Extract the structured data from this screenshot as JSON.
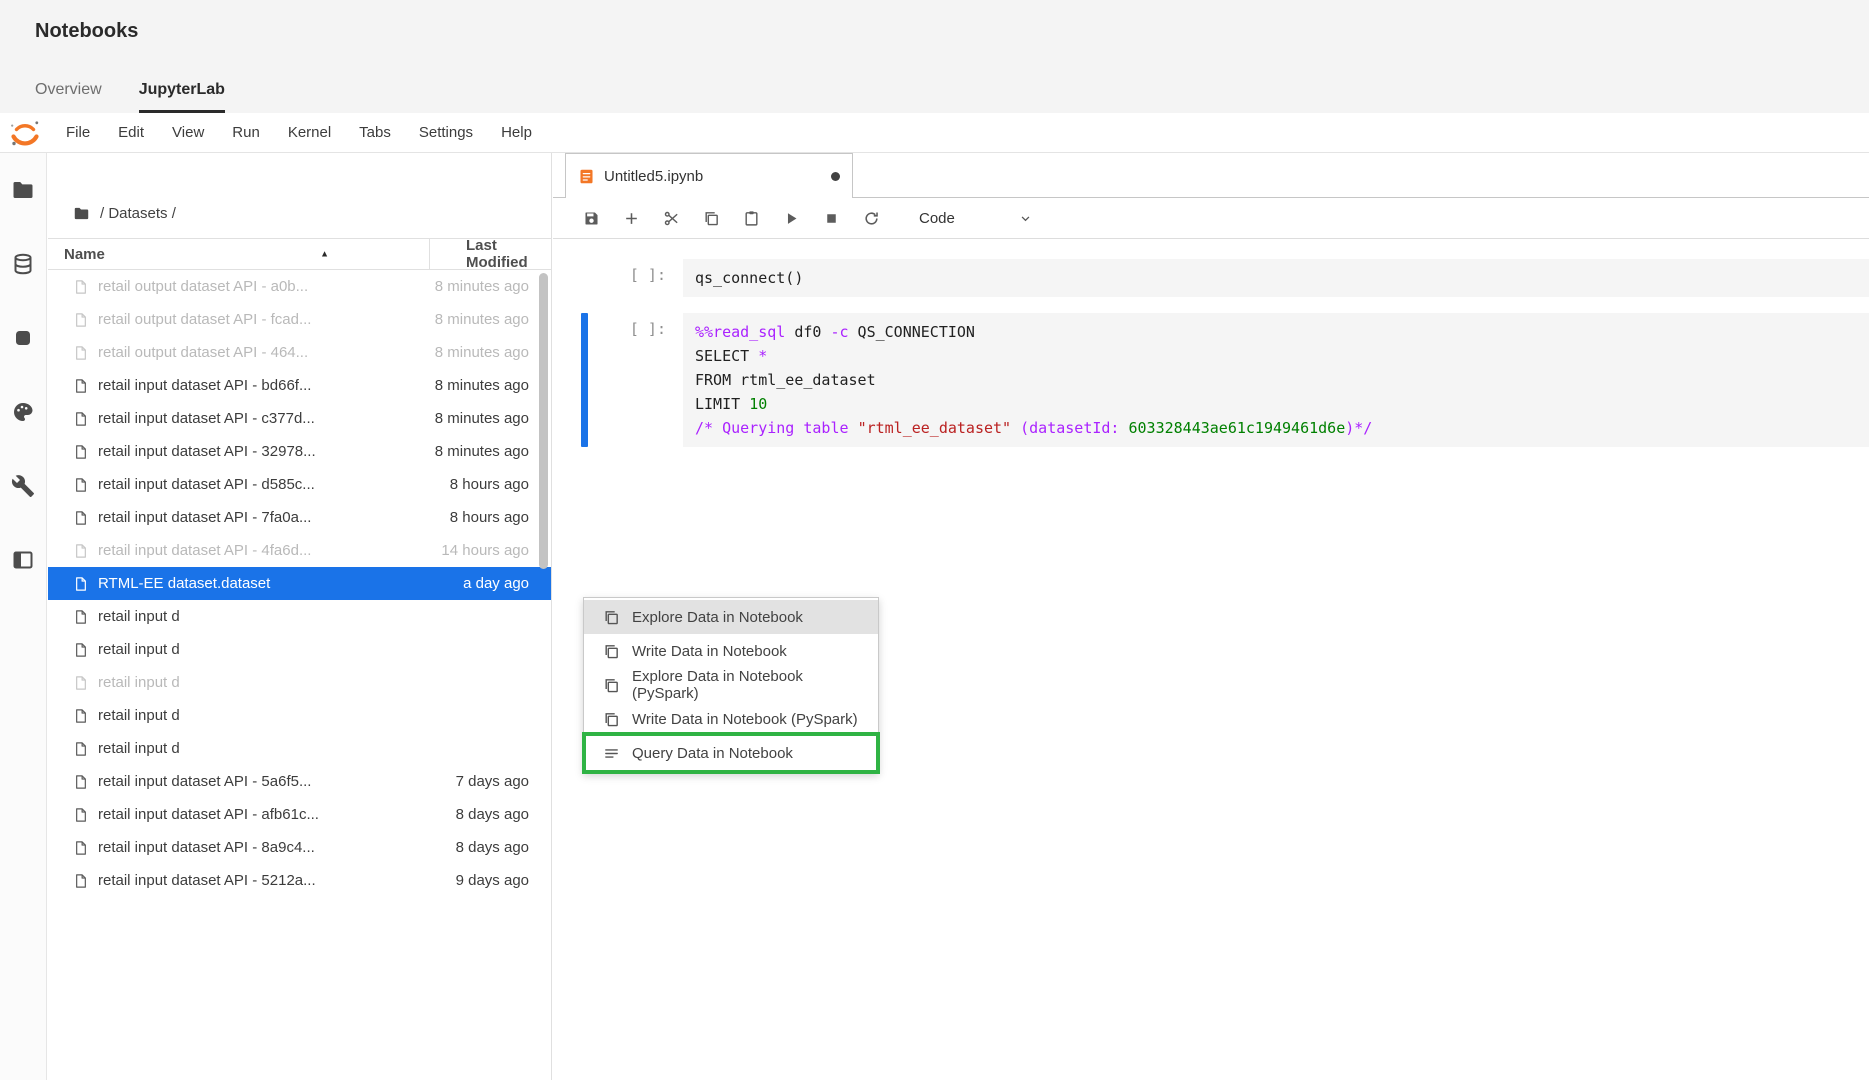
{
  "colors": {
    "brand_orange": "#F37726",
    "selection_blue": "#1A73E8",
    "annotation_green": "#2FB344",
    "syntax_magic": "#AA22FF",
    "syntax_number": "#008000",
    "syntax_string": "#BA2121"
  },
  "header": {
    "title": "Notebooks",
    "tabs": [
      {
        "label": "Overview",
        "active": false
      },
      {
        "label": "JupyterLab",
        "active": true
      }
    ]
  },
  "menubar": {
    "items": [
      "File",
      "Edit",
      "View",
      "Run",
      "Kernel",
      "Tabs",
      "Settings",
      "Help"
    ]
  },
  "sidebar": {
    "icons": [
      "folder",
      "database",
      "stop",
      "palette",
      "wrench",
      "panel"
    ]
  },
  "filebrowser": {
    "breadcrumb": "/ Datasets /",
    "columns": {
      "name": "Name",
      "modified": "Last Modified"
    },
    "sort": {
      "column": "Name",
      "direction": "ascending",
      "icon": "▲"
    },
    "rows": [
      {
        "name": "retail output dataset API - a0b...",
        "modified": "8 minutes ago",
        "state": "dim"
      },
      {
        "name": "retail output dataset API - fcad...",
        "modified": "8 minutes ago",
        "state": "dim"
      },
      {
        "name": "retail output dataset API - 464...",
        "modified": "8 minutes ago",
        "state": "dim"
      },
      {
        "name": "retail input dataset API - bd66f...",
        "modified": "8 minutes ago",
        "state": "normal"
      },
      {
        "name": "retail input dataset API - c377d...",
        "modified": "8 minutes ago",
        "state": "normal"
      },
      {
        "name": "retail input dataset API - 32978...",
        "modified": "8 minutes ago",
        "state": "normal"
      },
      {
        "name": "retail input dataset API - d585c...",
        "modified": "8 hours ago",
        "state": "normal"
      },
      {
        "name": "retail input dataset API - 7fa0a...",
        "modified": "8 hours ago",
        "state": "normal"
      },
      {
        "name": "retail input dataset API - 4fa6d...",
        "modified": "14 hours ago",
        "state": "dim"
      },
      {
        "name": "RTML-EE dataset.dataset",
        "modified": "a day ago",
        "state": "selected"
      },
      {
        "name": "retail input d",
        "modified": "",
        "state": "normal"
      },
      {
        "name": "retail input d",
        "modified": "",
        "state": "normal"
      },
      {
        "name": "retail input d",
        "modified": "",
        "state": "dim"
      },
      {
        "name": "retail input d",
        "modified": "",
        "state": "normal"
      },
      {
        "name": "retail input d",
        "modified": "",
        "state": "normal"
      },
      {
        "name": "retail input dataset API - 5a6f5...",
        "modified": "7 days ago",
        "state": "normal"
      },
      {
        "name": "retail input dataset API - afb61c...",
        "modified": "8 days ago",
        "state": "normal"
      },
      {
        "name": "retail input dataset API - 8a9c4...",
        "modified": "8 days ago",
        "state": "normal"
      },
      {
        "name": "retail input dataset API - 5212a...",
        "modified": "9 days ago",
        "state": "normal"
      }
    ]
  },
  "contextmenu": {
    "items": [
      {
        "label": "Explore Data in Notebook",
        "icon": "copy",
        "hover": true,
        "annotated": false
      },
      {
        "label": "Write Data in Notebook",
        "icon": "copy",
        "hover": false,
        "annotated": false
      },
      {
        "label": "Explore Data in Notebook (PySpark)",
        "icon": "copy",
        "hover": false,
        "annotated": false
      },
      {
        "label": "Write Data in Notebook (PySpark)",
        "icon": "copy",
        "hover": false,
        "annotated": false
      },
      {
        "label": "Query Data in Notebook",
        "icon": "query",
        "hover": false,
        "annotated": true
      }
    ]
  },
  "notebook": {
    "tab": {
      "title": "Untitled5.ipynb",
      "dirty": true
    },
    "toolbar": {
      "icons": [
        "save",
        "add",
        "cut",
        "copy",
        "paste",
        "run",
        "stop",
        "restart"
      ],
      "mode": "Code"
    },
    "cells": [
      {
        "prompt": "[ ]:",
        "active": false,
        "lines": [
          [
            [
              "plain",
              "qs_connect()"
            ]
          ]
        ]
      },
      {
        "prompt": "[ ]:",
        "active": true,
        "lines": [
          [
            [
              "magic",
              "%%read_sql"
            ],
            [
              "plain",
              " df0 "
            ],
            [
              "magic",
              "-c"
            ],
            [
              "plain",
              " QS_CONNECTION"
            ]
          ],
          [
            [
              "plain",
              "SELECT "
            ],
            [
              "magic",
              "*"
            ]
          ],
          [
            [
              "plain",
              "FROM rtml_ee_dataset"
            ]
          ],
          [
            [
              "plain",
              "LIMIT "
            ],
            [
              "num",
              "10"
            ]
          ],
          [
            [
              "magic",
              "/* Querying table "
            ],
            [
              "str",
              "\"rtml_ee_dataset\""
            ],
            [
              "magic",
              " (datasetId: "
            ],
            [
              "num",
              "603328443ae61c1949461d6e"
            ],
            [
              "magic",
              ")*/"
            ]
          ]
        ]
      }
    ]
  }
}
